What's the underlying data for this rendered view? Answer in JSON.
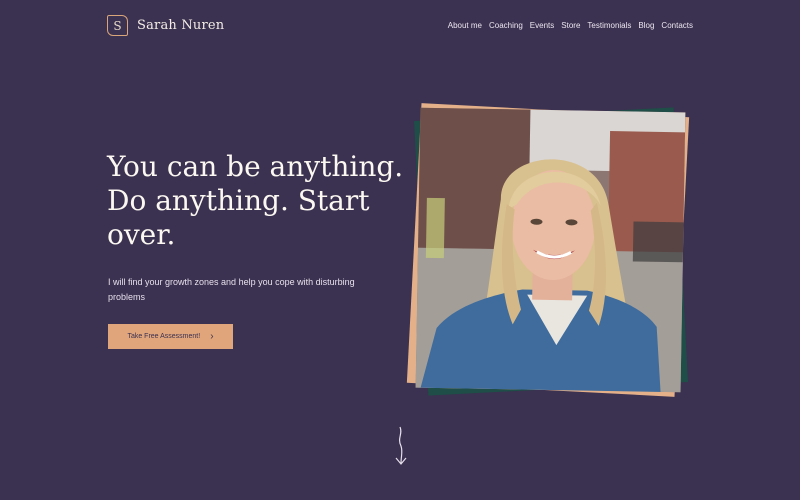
{
  "header": {
    "logo_letter": "S",
    "logo_text": "Sarah Nuren",
    "nav": [
      {
        "label": "About me"
      },
      {
        "label": "Coaching"
      },
      {
        "label": "Events"
      },
      {
        "label": "Store"
      },
      {
        "label": "Testimonials"
      },
      {
        "label": "Blog"
      },
      {
        "label": "Contacts"
      }
    ]
  },
  "hero": {
    "headline_line1": "You can be anything.",
    "headline_line2": "Do anything. Start",
    "headline_line3": "over.",
    "subtext": "I will find your growth zones and help you cope with disturbing problems",
    "cta_label": "Take Free Assessment!",
    "cta_icon": "chevron-right-icon"
  },
  "photo": {
    "alt": "smiling woman portrait"
  },
  "scroll": {
    "icon": "arrow-down-icon"
  },
  "colors": {
    "background": "#3b3150",
    "accent": "#e0a57b",
    "frame_green": "#1f4d48",
    "text": "#fbf7f1"
  }
}
